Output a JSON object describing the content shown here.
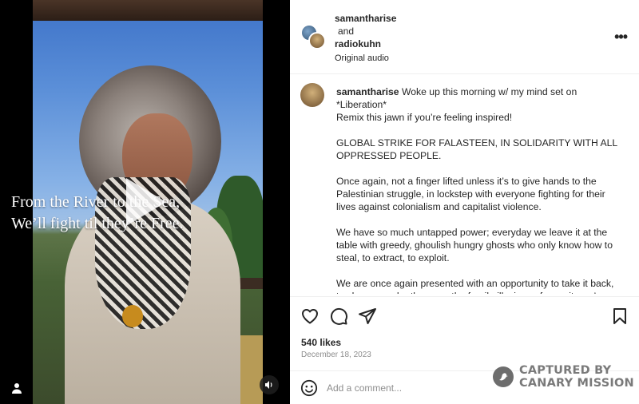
{
  "media": {
    "overlay_text": "From the River to the Sea,\nWe’ll fight til they’re Free.",
    "icons": {
      "play": "play-icon",
      "user_tag": "user-tag-icon",
      "sound": "sound-icon"
    }
  },
  "header": {
    "author1": "samantharise",
    "and": "and",
    "author2": "radiokuhn",
    "audio": "Original audio",
    "more_icon": "more-options-icon"
  },
  "post": {
    "username": "samantharise",
    "paragraphs": [
      "Woke up this morning w/ my mind set on\n*Liberation*\nRemix this jawn if you’re feeling inspired!",
      "GLOBAL STRIKE FOR FALASTEEN, IN SOLIDARITY WITH ALL OPPRESSED PEOPLE.",
      "Once again, not a finger lifted unless it’s to give hands to the Palestinian struggle, in lockstep with everyone fighting for their lives against colonialism and capitalist violence.",
      "We have so much untapped power; everyday we leave it at the table with greedy, ghoulish hungry ghosts who only know how to steal, to extract, to exploit.",
      "We are once again presented with an opportunity to take it back, to choose each other over the fragile illusions of security we’ve"
    ]
  },
  "actions": {
    "icons": [
      "heart-icon",
      "comment-icon",
      "share-icon",
      "bookmark-icon"
    ],
    "likes": "540 likes",
    "date": "December 18, 2023"
  },
  "comment": {
    "placeholder": "Add a comment...",
    "emoji_icon": "emoji-icon"
  },
  "watermark": {
    "line1": "CAPTURED BY",
    "line2": "CANARY MISSION"
  }
}
